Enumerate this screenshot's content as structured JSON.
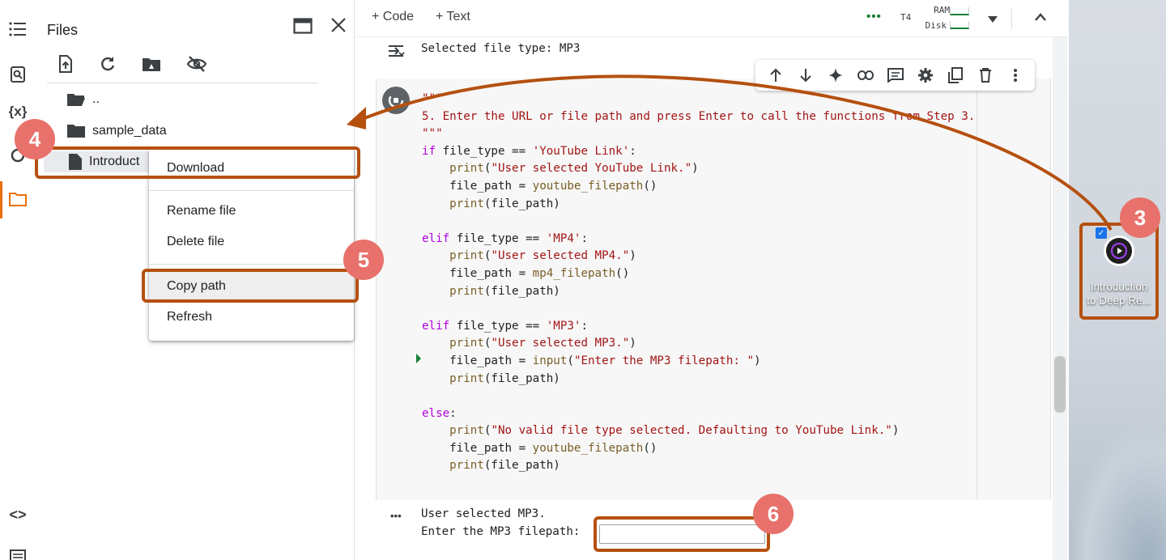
{
  "rail": {
    "icons": [
      "toc-icon",
      "find-icon",
      "variables-icon",
      "secrets-icon",
      "folder-icon",
      "code-snippets-icon",
      "terminal-icon"
    ],
    "variables_label": "{x}",
    "snippets_label": "<>"
  },
  "files_panel": {
    "title": "Files",
    "tree": [
      {
        "name": "..",
        "kind": "parent-folder"
      },
      {
        "name": "sample_data",
        "kind": "folder"
      },
      {
        "name": "Introduct",
        "kind": "file"
      }
    ]
  },
  "context_menu": {
    "items": [
      "Download",
      "Rename file",
      "Delete file",
      "Copy path",
      "Refresh"
    ]
  },
  "toolbar": {
    "add_code": "+ Code",
    "add_text": "+ Text",
    "runtime": "T4",
    "ram_label": "RAM",
    "disk_label": "Disk",
    "status_dots": "•••"
  },
  "output_top": "Selected file type: MP3",
  "code_lines": [
    "\"\"\"",
    "5. Enter the URL or file path and press Enter to call the functions from Step 3.",
    "\"\"\"",
    "if file_type == 'YouTube Link':",
    "    print(\"User selected YouTube Link.\")",
    "    file_path = youtube_filepath()",
    "    print(file_path)",
    "",
    "elif file_type == 'MP4':",
    "    print(\"User selected MP4.\")",
    "    file_path = mp4_filepath()",
    "    print(file_path)",
    "",
    "elif file_type == 'MP3':",
    "    print(\"User selected MP3.\")",
    "    file_path = input(\"Enter the MP3 filepath: \")",
    "    print(file_path)",
    "",
    "else:",
    "    print(\"No valid file type selected. Defaulting to YouTube Link.\")",
    "    file_path = youtube_filepath()",
    "    print(file_path)"
  ],
  "output_bottom": {
    "dots": "•••",
    "line1": "User selected MP3.",
    "line2": "Enter the MP3 filepath:",
    "input_value": ""
  },
  "desktop_file": {
    "label_line1": "Introduction",
    "label_line2": "to Deep Re..."
  },
  "annotations": [
    "3",
    "4",
    "5",
    "6"
  ],
  "colors": {
    "annotation_border": "#b5500f",
    "badge": "#e8716b",
    "accent_rail": "#e8710a"
  }
}
